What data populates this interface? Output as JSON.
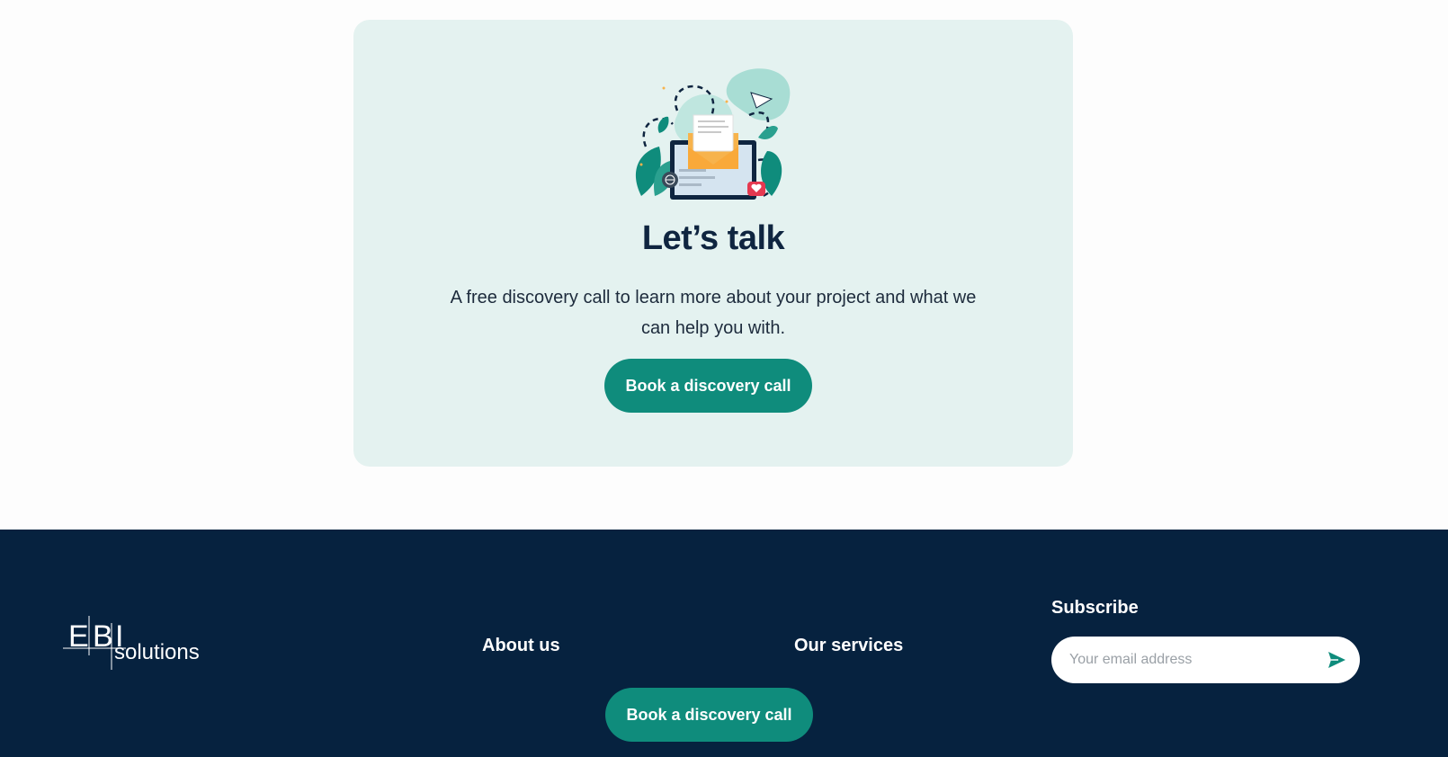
{
  "cta": {
    "title": "Let’s talk",
    "description": "A free discovery call to learn more about your project and what we can help you with.",
    "button_label": "Book a discovery call"
  },
  "footer": {
    "logo_text": "EBI solutions",
    "links": [
      {
        "label": "About us"
      },
      {
        "label": "Our services"
      }
    ],
    "subscribe": {
      "title": "Subscribe",
      "placeholder": "Your email address"
    },
    "button_label": "Book a discovery call"
  },
  "colors": {
    "accent": "#0f8c7c",
    "footer_bg": "#06223f",
    "card_bg": "#e4f2f0"
  }
}
